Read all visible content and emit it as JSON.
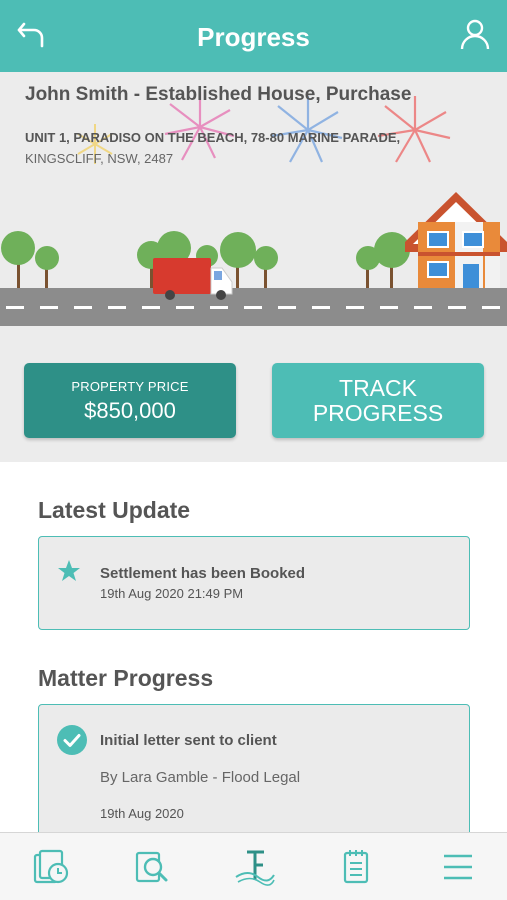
{
  "header": {
    "title": "Progress",
    "back_icon": "back-arrow-icon",
    "user_icon": "user-icon",
    "color": "#4dbdb5"
  },
  "matter": {
    "client_title": "John Smith - Established House, Purchase",
    "address_line1": "UNIT 1, PARADISO ON THE BEACH, 78-80 MARINE PARADE,",
    "address_line2": "KINGSCLIFF, NSW, 2487"
  },
  "actions": {
    "price_label": "PROPERTY PRICE",
    "price_value": "$850,000",
    "track_line1": "TRACK",
    "track_line2": "PROGRESS"
  },
  "latest_update": {
    "heading": "Latest Update",
    "title": "Settlement has been Booked",
    "timestamp": "19th Aug 2020 21:49 PM",
    "icon": "star-icon"
  },
  "matter_progress": {
    "heading": "Matter Progress",
    "items": [
      {
        "title": "Initial letter sent to client",
        "by": "By Lara Gamble - Flood Legal",
        "date": "19th Aug 2020",
        "icon": "check-circle-icon"
      }
    ]
  },
  "tabbar": {
    "items": [
      {
        "icon": "documents-clock-icon"
      },
      {
        "icon": "search-document-icon"
      },
      {
        "icon": "brand-logo-icon"
      },
      {
        "icon": "notepad-icon"
      },
      {
        "icon": "menu-icon"
      }
    ]
  },
  "colors": {
    "accent": "#4dbdb5",
    "accent_dark": "#2e9087",
    "text": "#555555"
  }
}
